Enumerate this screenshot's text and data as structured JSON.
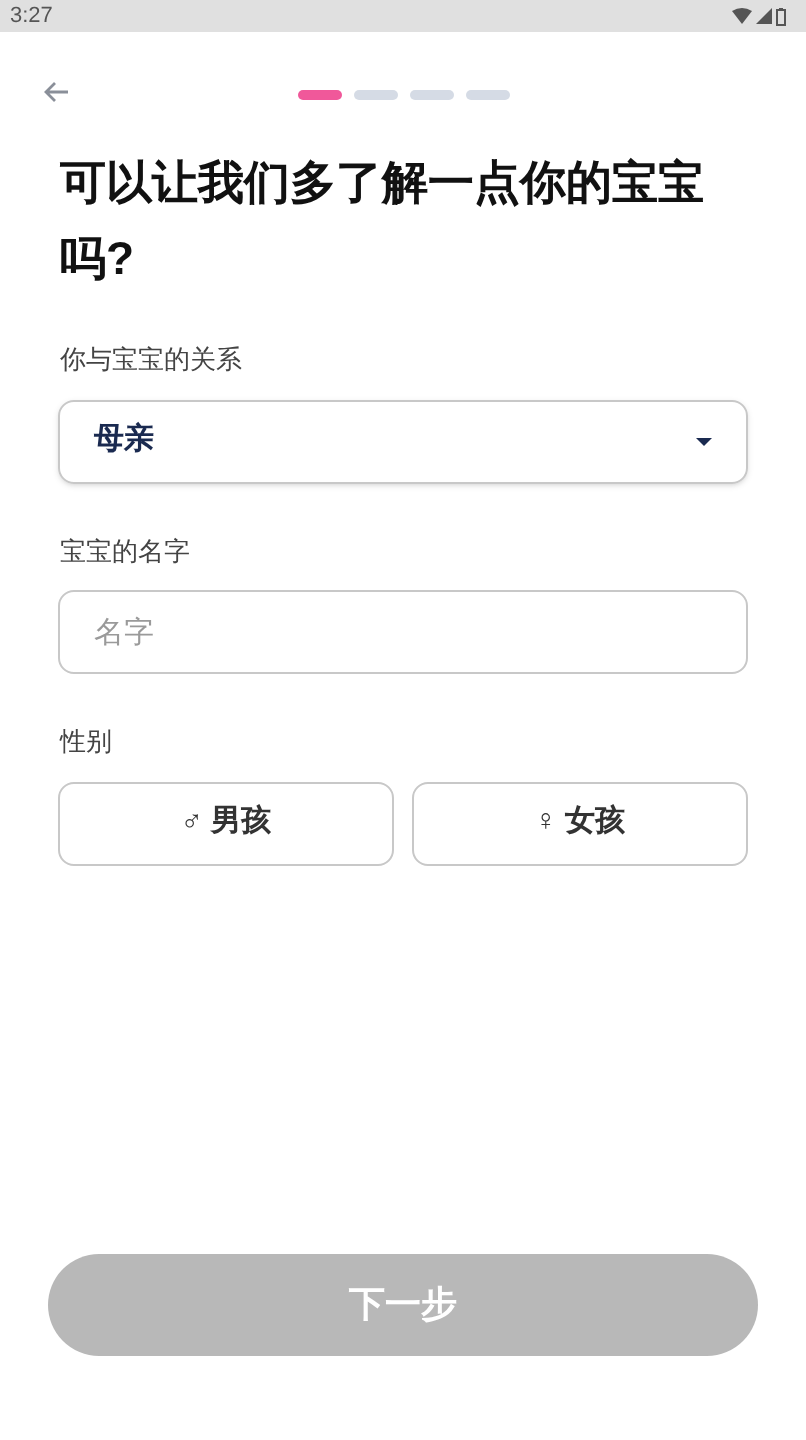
{
  "status_bar": {
    "time": "3:27"
  },
  "progress_steps": [
    {
      "selected": true
    },
    {
      "selected": false
    },
    {
      "selected": false
    },
    {
      "selected": false
    }
  ],
  "title": "可以让我们多了解一点你的宝宝吗?",
  "relation": {
    "label": "你与宝宝的关系",
    "value": "母亲"
  },
  "baby_name": {
    "label": "宝宝的名字",
    "placeholder": "名字"
  },
  "gender": {
    "label": "性别",
    "options": [
      {
        "label": "♂ 男孩",
        "selected": false
      },
      {
        "label": "♀ 女孩",
        "selected": false
      }
    ]
  },
  "next_button": {
    "label": "下一步",
    "disabled": true
  }
}
